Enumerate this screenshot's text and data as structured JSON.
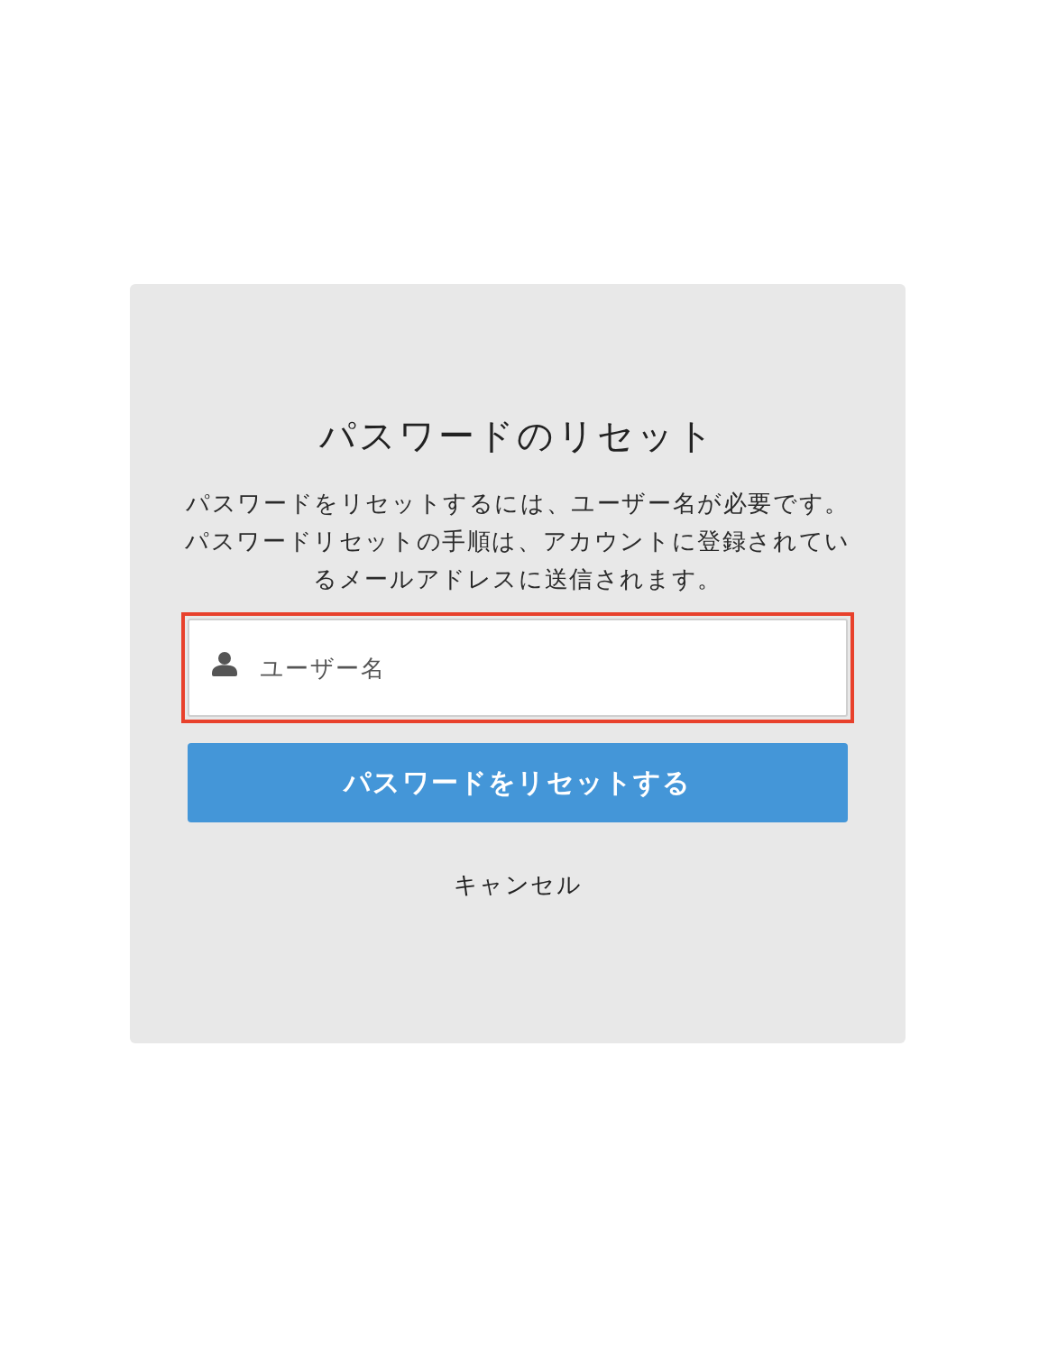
{
  "card": {
    "title": "パスワードのリセット",
    "description": "パスワードをリセットするには、ユーザー名が必要です。パスワードリセットの手順は、アカウントに登録されているメールアドレスに送信されます。",
    "username_field": {
      "placeholder": "ユーザー名",
      "highlighted": true
    },
    "submit_button": {
      "label": "パスワードをリセットする"
    },
    "cancel_link": {
      "label": "キャンセル"
    }
  }
}
